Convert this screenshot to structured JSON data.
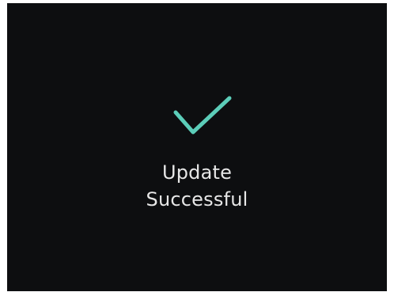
{
  "screen": {
    "icon": "checkmark-icon",
    "accent_color": "#5ccdb9",
    "background_color": "#0d0e10",
    "message_line1": "Update",
    "message_line2": "Successful"
  }
}
